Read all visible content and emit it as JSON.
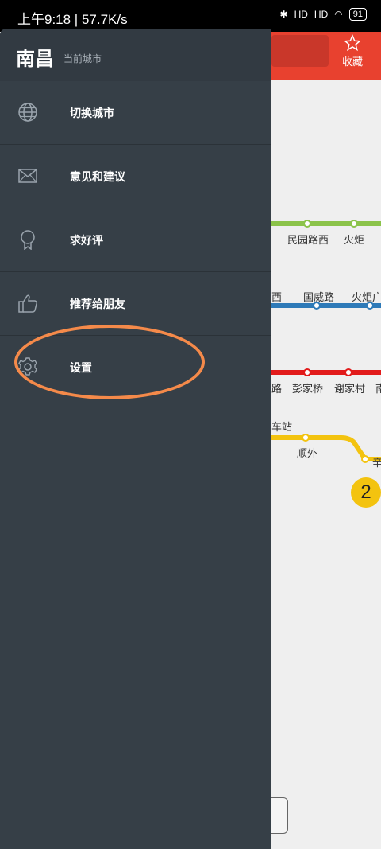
{
  "status_bar": {
    "left_text": "上午9:18 | 57.7K/s",
    "signal1": "HD",
    "signal2": "HD",
    "battery": "91"
  },
  "map": {
    "favorite_label": "收藏",
    "stations": [
      "民园路西",
      "火炬",
      "西",
      "国威路",
      "火炬广",
      "路",
      "彭家桥",
      "谢家村",
      "南",
      "车站",
      "顺外",
      "辛"
    ],
    "line_badge": "2",
    "line_colors": {
      "green": "#8bc34a",
      "blue": "#2e7ab8",
      "red": "#e21b1b",
      "yellow": "#f3c30f"
    }
  },
  "drawer": {
    "city": "南昌",
    "city_sub": "当前城市",
    "items": [
      {
        "label": "切换城市",
        "icon": "globe-icon"
      },
      {
        "label": "意见和建议",
        "icon": "mail-icon"
      },
      {
        "label": "求好评",
        "icon": "award-icon"
      },
      {
        "label": "推荐给朋友",
        "icon": "thumbs-up-icon"
      },
      {
        "label": "设置",
        "icon": "gear-icon"
      }
    ]
  }
}
